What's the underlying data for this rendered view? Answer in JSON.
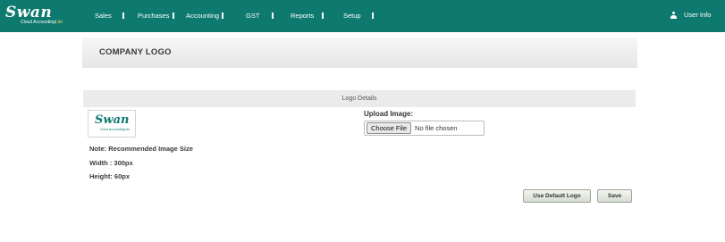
{
  "brand": {
    "name": "Swan",
    "tagline_main": "Cloud Accounting",
    "tagline_accent": "Lite"
  },
  "nav": {
    "items": [
      {
        "label": "Sales"
      },
      {
        "label": "Purchases"
      },
      {
        "label": "Accounting"
      },
      {
        "label": "GST"
      },
      {
        "label": "Reports"
      },
      {
        "label": "Setup"
      }
    ],
    "user_info": "User Info"
  },
  "page": {
    "title": "COMPANY LOGO"
  },
  "logo_details": {
    "section_title": "Logo Details",
    "note": "Note: Recommended Image Size",
    "width": "Width : 300px",
    "height": "Height: 60px",
    "upload_label": "Upload Image:",
    "file_button": "Choose File",
    "file_status": "No file chosen"
  },
  "actions": {
    "use_default": "Use Default Logo",
    "save": "Save"
  },
  "colors": {
    "nav_bg": "#0e7a6f",
    "accent": "#f3c84b"
  },
  "icons": {
    "user": "user-icon"
  }
}
